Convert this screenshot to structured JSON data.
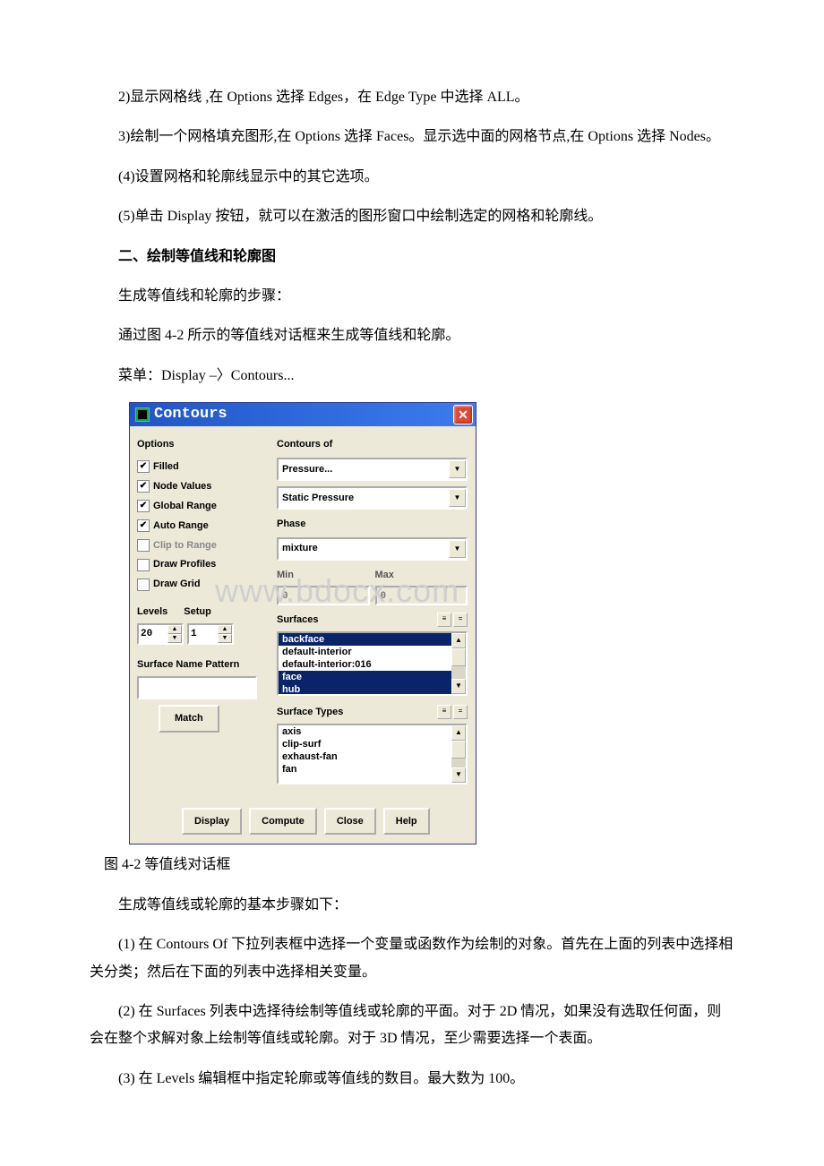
{
  "paragraphs": {
    "p1": "2)显示网格线 ,在 Options 选择 Edges，在 Edge Type 中选择 ALL。",
    "p2": "3)绘制一个网格填充图形,在 Options 选择 Faces。显示选中面的网格节点,在 Options 选择 Nodes。",
    "p3": "(4)设置网格和轮廓线显示中的其它选项。",
    "p4": "(5)单击 Display 按钮，就可以在激活的图形窗口中绘制选定的网格和轮廓线。",
    "h1": "二、绘制等值线和轮廓图",
    "p5": "生成等值线和轮廓的步骤：",
    "p6": "通过图 4-2 所示的等值线对话框来生成等值线和轮廓。",
    "p7": "菜单：Display –〉Contours...",
    "caption": "图 4-2 等值线对话框",
    "p8": "生成等值线或轮廓的基本步骤如下：",
    "p9": "(1) 在 Contours Of 下拉列表框中选择一个变量或函数作为绘制的对象。首先在上面的列表中选择相关分类；然后在下面的列表中选择相关变量。",
    "p10": "(2) 在 Surfaces 列表中选择待绘制等值线或轮廓的平面。对于 2D 情况，如果没有选取任何面，则会在整个求解对象上绘制等值线或轮廓。对于 3D 情况，至少需要选择一个表面。",
    "p11": "(3) 在 Levels 编辑框中指定轮廓或等值线的数目。最大数为 100。"
  },
  "watermark": "www.bdocx.com",
  "dialog": {
    "title": "Contours",
    "options_label": "Options",
    "checkboxes": {
      "filled": "Filled",
      "node": "Node Values",
      "global": "Global Range",
      "auto": "Auto Range",
      "clip": "Clip to Range",
      "profiles": "Draw Profiles",
      "grid": "Draw Grid"
    },
    "levels_label": "Levels",
    "setup_label": "Setup",
    "levels_value": "20",
    "setup_value": "1",
    "snp_label": "Surface Name Pattern",
    "match_btn": "Match",
    "contours_of": "Contours of",
    "dd1": "Pressure...",
    "dd2": "Static Pressure",
    "phase_label": "Phase",
    "dd_phase": "mixture",
    "min_label": "Min",
    "max_label": "Max",
    "min_value": "0",
    "max_value": "0",
    "surfaces_label": "Surfaces",
    "surfaces": {
      "s0": "backface",
      "s1": "default-interior",
      "s2": "default-interior:016",
      "s3": "face",
      "s4": "hub"
    },
    "surface_types_label": "Surface Types",
    "surface_types": {
      "t0": "axis",
      "t1": "clip-surf",
      "t2": "exhaust-fan",
      "t3": "fan"
    },
    "buttons": {
      "display": "Display",
      "compute": "Compute",
      "close": "Close",
      "help": "Help"
    }
  }
}
